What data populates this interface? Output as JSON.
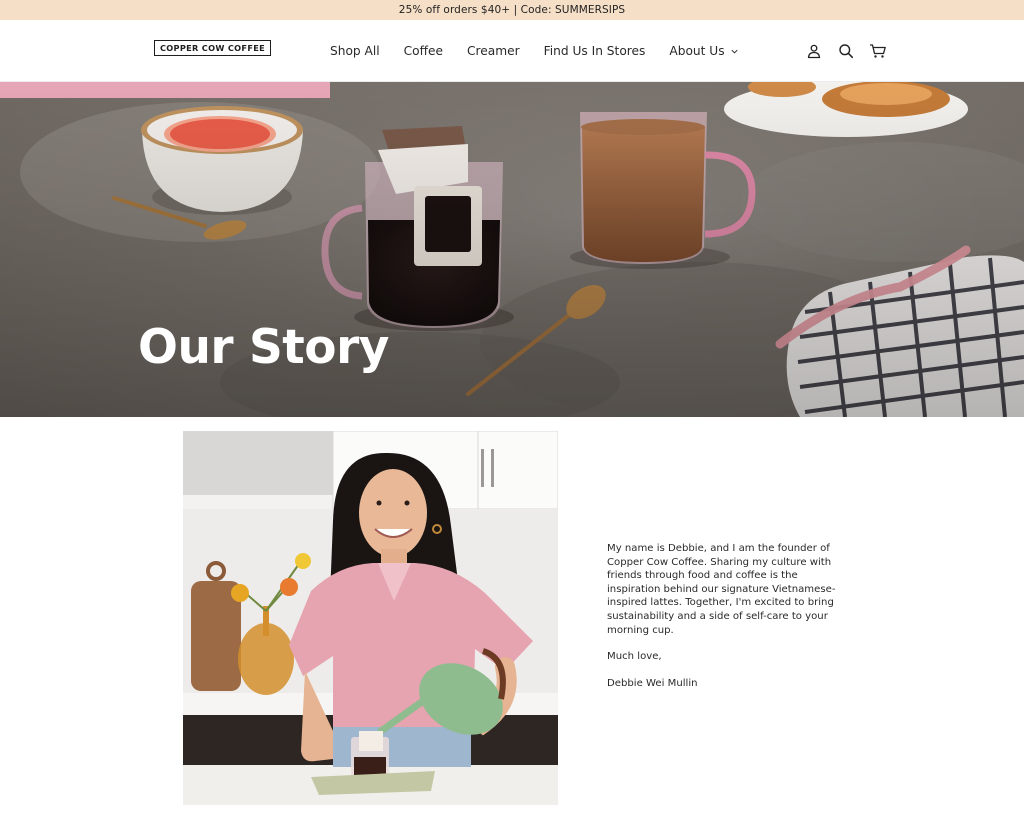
{
  "announcement": {
    "text": "25% off orders $40+ | Code: SUMMERSIPS"
  },
  "header": {
    "logo": "COPPER COW COFFEE",
    "nav": [
      {
        "label": "Shop All"
      },
      {
        "label": "Coffee"
      },
      {
        "label": "Creamer"
      },
      {
        "label": "Find Us In Stores"
      },
      {
        "label": "About Us",
        "has_dropdown": true
      }
    ],
    "icons": [
      "account-icon",
      "search-icon",
      "cart-icon"
    ]
  },
  "hero": {
    "title": "Our Story"
  },
  "story": {
    "paragraph": "My name is Debbie, and I am the founder of Copper Cow Coffee. Sharing my culture with friends through food and coffee is the inspiration behind our signature Vietnamese-inspired lattes. Together, I'm excited to bring sustainability and a side of self-care to your morning cup.",
    "signoff": "Much love,",
    "signature": "Debbie Wei Mullin"
  },
  "colors": {
    "announcement_bg": "#f6dfc7",
    "hero_text": "#ffffff",
    "text": "#1f1f1f"
  }
}
